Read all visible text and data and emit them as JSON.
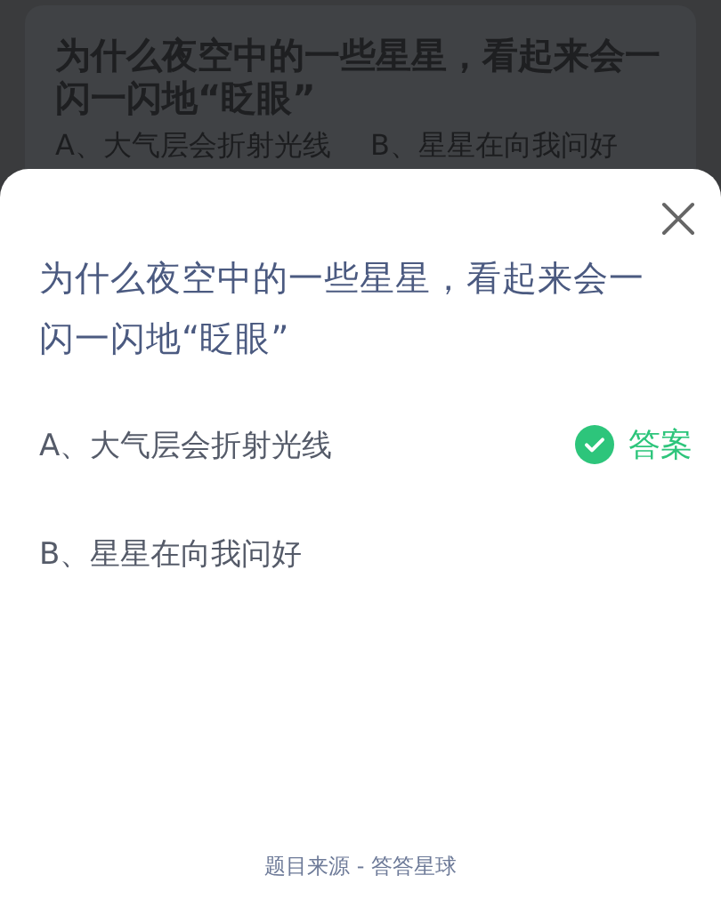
{
  "background": {
    "question": "为什么夜空中的一些星星，看起来会一闪一闪地“眨眼”",
    "options": [
      "A、大气层会折射光线",
      "B、星星在向我问好"
    ]
  },
  "sheet": {
    "question": "为什么夜空中的一些星星，看起来会一闪一闪地“眨眼”",
    "answer_label": "答案",
    "options": [
      {
        "label": "A、大气层会折射光线",
        "correct": true
      },
      {
        "label": "B、星星在向我问好",
        "correct": false
      }
    ],
    "footer": "题目来源 - 答答星球"
  }
}
